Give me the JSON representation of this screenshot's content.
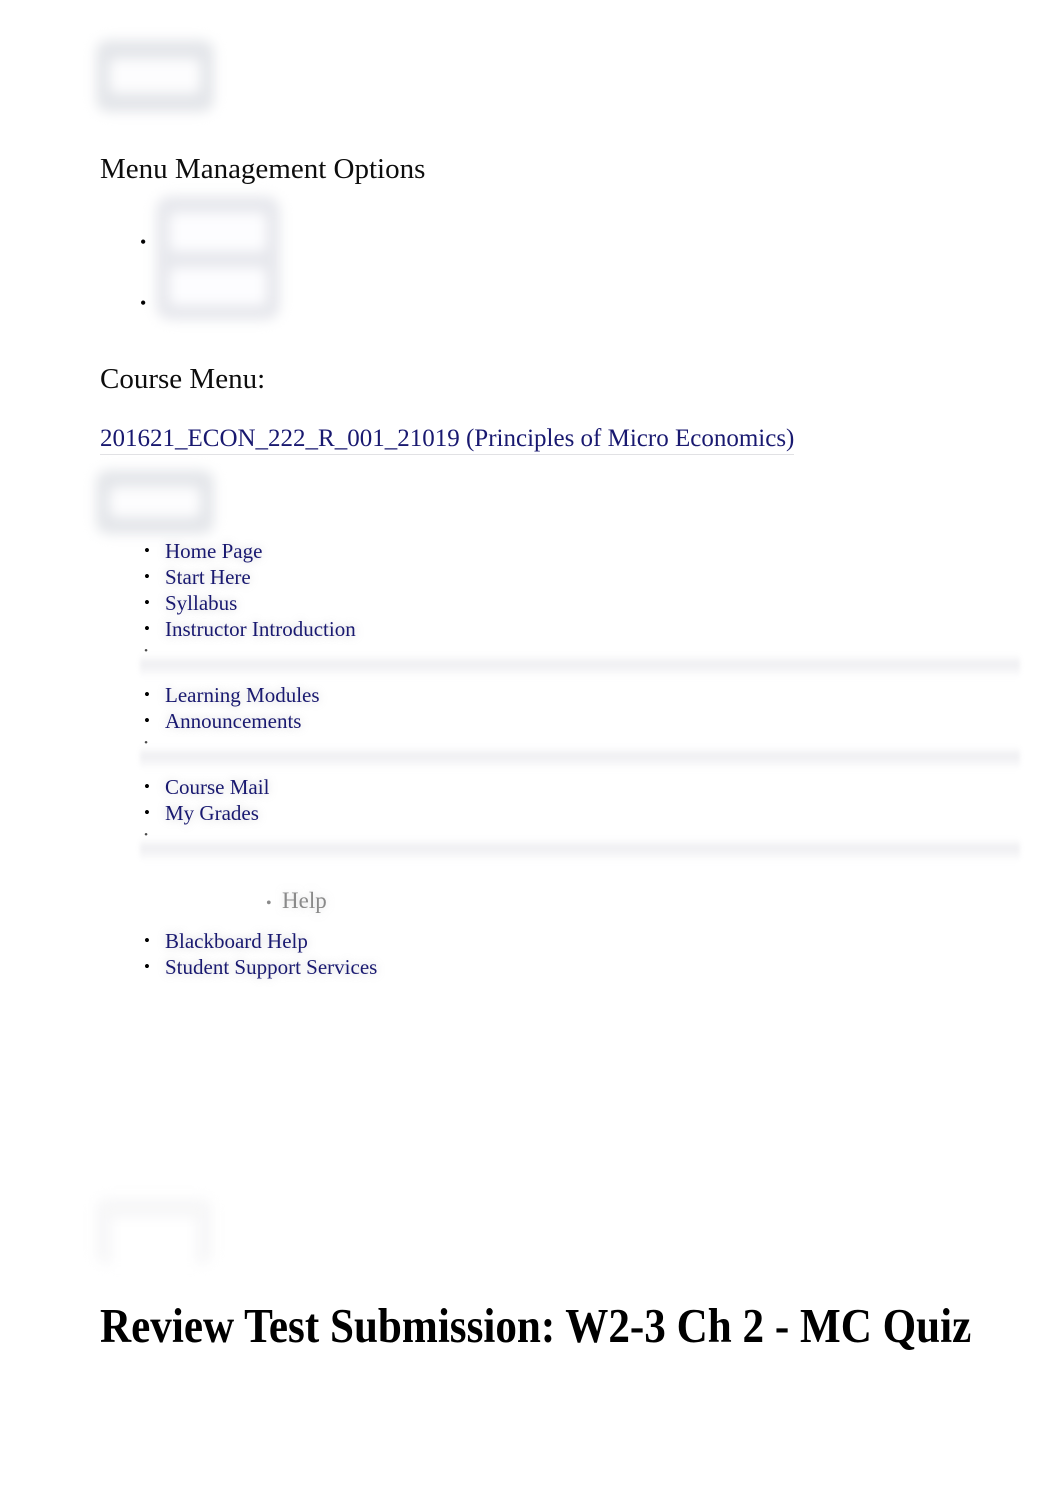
{
  "page": {
    "title": "Review Test Submission: W2-3 Ch 2 - MC Quiz"
  },
  "menu_management": {
    "heading": "Menu Management Options",
    "option_bullets": [
      "",
      ""
    ]
  },
  "course_menu": {
    "heading": "Course Menu:",
    "course_link": "201621_ECON_222_R_001_21019 (Principles of Micro Economics)",
    "items": [
      {
        "label": "Home Page",
        "type": "link"
      },
      {
        "label": "Start Here",
        "type": "link"
      },
      {
        "label": "Syllabus",
        "type": "link"
      },
      {
        "label": "Instructor Introduction",
        "type": "link"
      },
      {
        "label": "",
        "type": "divider"
      },
      {
        "label": "Learning Modules",
        "type": "link"
      },
      {
        "label": "Announcements",
        "type": "link"
      },
      {
        "label": "",
        "type": "divider"
      },
      {
        "label": "Course Mail",
        "type": "link"
      },
      {
        "label": "My Grades",
        "type": "link"
      },
      {
        "label": "",
        "type": "divider"
      }
    ],
    "help_section": {
      "label": "Help",
      "items": [
        {
          "label": "Blackboard Help",
          "type": "link"
        },
        {
          "label": "Student Support Services",
          "type": "link"
        }
      ]
    }
  },
  "colors": {
    "link": "#191970",
    "heading": "#0d0d0d",
    "muted": "#8a8a8a"
  },
  "bullet_glyph": "•"
}
